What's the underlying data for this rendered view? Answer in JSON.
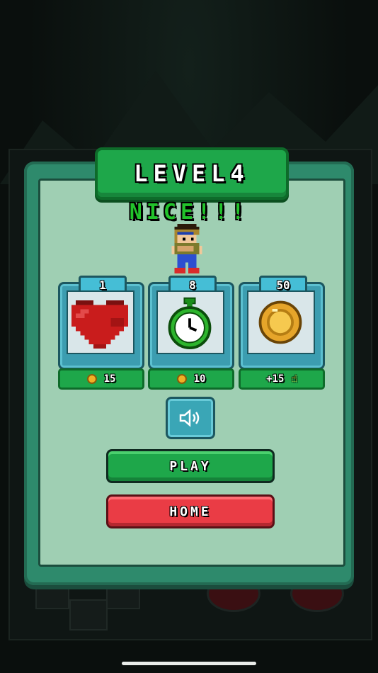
{
  "level_banner": "LEVEL4",
  "result_text": "NICE!!!",
  "rewards": [
    {
      "count": "1",
      "item": "heart-icon",
      "price": "15",
      "price_icon": "coin-icon"
    },
    {
      "count": "8",
      "item": "stopwatch-icon",
      "price": "10",
      "price_icon": "coin-icon"
    },
    {
      "count": "50",
      "item": "coin-icon",
      "price": "+15",
      "price_icon": "pointer-icon"
    }
  ],
  "buttons": {
    "sound": "speaker-icon",
    "play": "PLAY",
    "home": "HOME"
  },
  "colors": {
    "panel": "#2e8a6c",
    "panel_inner": "#9fcfb3",
    "green": "#1ea74a",
    "red": "#ea3c45",
    "card": "#3c9db0",
    "text_green": "#22c32b"
  }
}
